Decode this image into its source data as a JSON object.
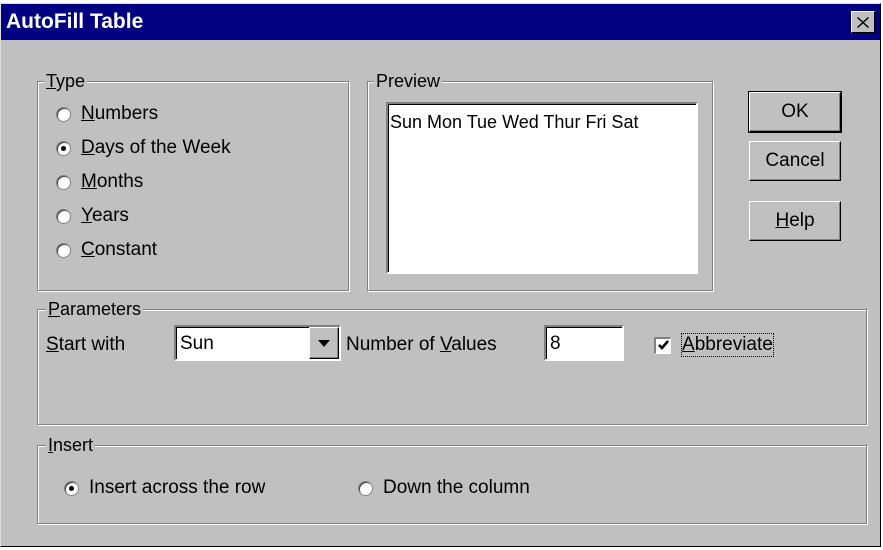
{
  "window": {
    "title": "AutoFill Table",
    "close_glyph": "×"
  },
  "type_group": {
    "legend_key": "T",
    "legend_rest": "ype",
    "options": [
      {
        "key": "N",
        "rest": "umbers",
        "checked": false
      },
      {
        "key": "D",
        "rest": "ays of the Week",
        "checked": true
      },
      {
        "key": "M",
        "rest": "onths",
        "checked": false
      },
      {
        "key": "Y",
        "rest": "ears",
        "checked": false
      },
      {
        "key": "C",
        "rest": "onstant",
        "checked": false
      }
    ]
  },
  "preview_group": {
    "legend": "Preview",
    "text": "Sun Mon Tue Wed Thur Fri Sat"
  },
  "buttons": {
    "ok": "OK",
    "cancel": "Cancel",
    "help_key": "H",
    "help_rest": "elp"
  },
  "parameters": {
    "legend_key": "P",
    "legend_rest": "arameters",
    "start_with_key": "S",
    "start_with_rest": "tart with",
    "start_value": "Sun",
    "num_values_pre": "Number of ",
    "num_values_key": "V",
    "num_values_post": "alues",
    "num_values": "8",
    "abbreviate_key": "A",
    "abbreviate_rest": "bbreviate",
    "abbreviate_checked": true
  },
  "insert": {
    "legend_key": "I",
    "legend_rest": "nsert",
    "across_label": "Insert across the row",
    "across_checked": true,
    "down_label": "Down the column",
    "down_checked": false
  }
}
